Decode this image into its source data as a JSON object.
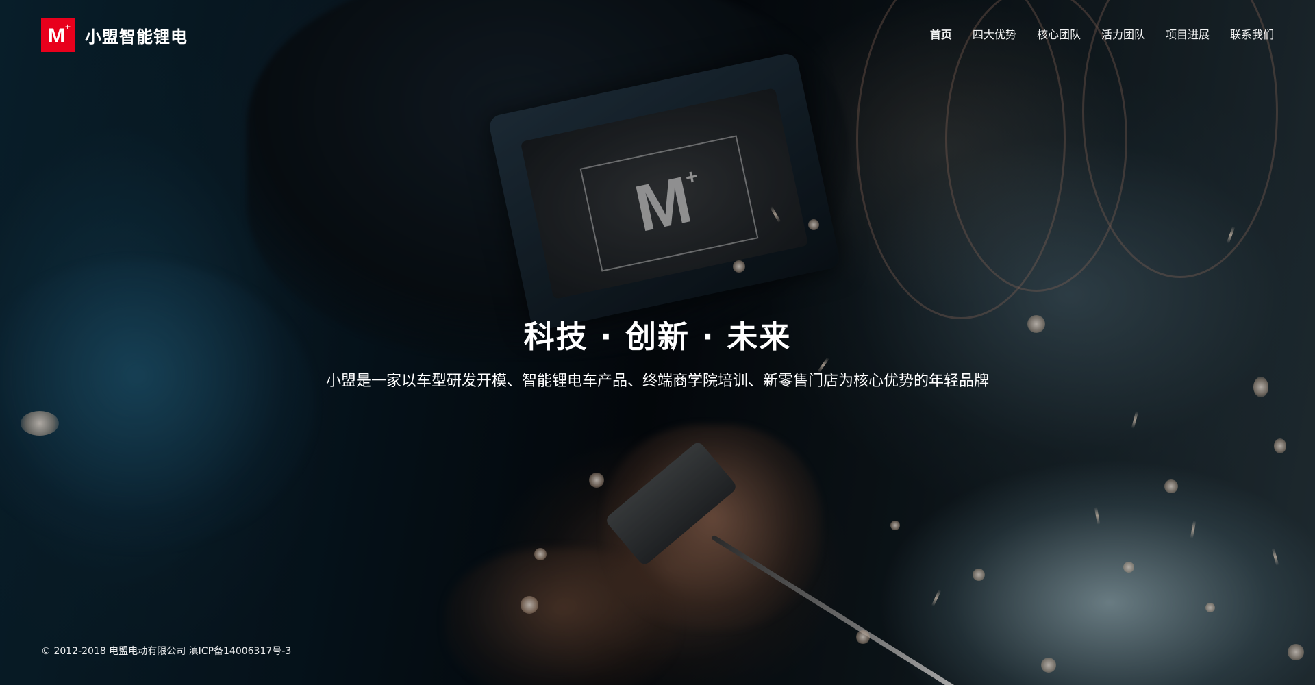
{
  "brand": {
    "logo_mark": "M",
    "logo_plus": "+",
    "name": "小盟智能锂电",
    "color": "#e8001c"
  },
  "nav": {
    "items": [
      {
        "label": "首页",
        "active": true
      },
      {
        "label": "四大优势",
        "active": false
      },
      {
        "label": "核心团队",
        "active": false
      },
      {
        "label": "活力团队",
        "active": false
      },
      {
        "label": "项目进展",
        "active": false
      },
      {
        "label": "联系我们",
        "active": false
      }
    ]
  },
  "hero": {
    "title": "科技 · 创新 · 未来",
    "subtitle": "小盟是一家以车型研发开模、智能锂电车产品、终端商学院培训、新零售门店为核心优势的年轻品牌",
    "visor_logo": "M",
    "visor_logo_plus": "+"
  },
  "footer": {
    "copyright": "© 2012-2018 电盟电动有限公司 滇ICP备14006317号-3"
  }
}
